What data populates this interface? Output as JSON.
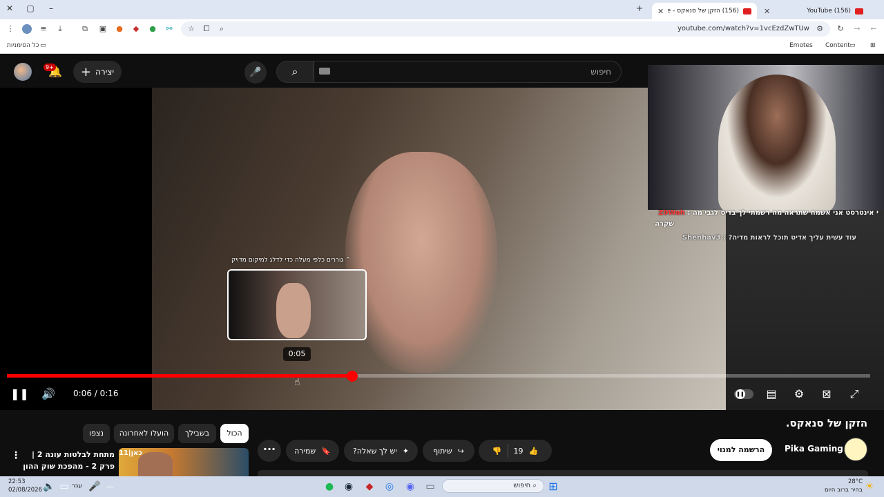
{
  "browser": {
    "tabs": [
      {
        "label": "(156) YouTube"
      },
      {
        "label": "(156) הזקן של סנאקס - be"
      }
    ],
    "new_tab": "+",
    "url": "youtube.com/watch?v=1vcEzdZwTUw",
    "bookmarks": {
      "all_bookmarks": "כל הסימניות",
      "emotes": "Emotes",
      "content": "Content"
    }
  },
  "header": {
    "notifications_badge": "9+",
    "create_label": "יצירה",
    "search_placeholder": "חיפוש"
  },
  "player": {
    "current_time": "0:06",
    "duration": "0:16",
    "timeline_text": "0:06 / 0:16",
    "progress_fraction": 0.4,
    "hover_time": "0:05",
    "preview_hint": "גוררים כלפי מעלה כדי לדלג למיקום מדויק"
  },
  "stream_overlay": {
    "chat": [
      {
        "user": "Z0Wah",
        "text": "י אינטרסט אני אשמח שתראה מה רשמתי לך בדיס לגבי מה :"
      },
      {
        "user": "",
        "text": "שקרה"
      },
      {
        "user": "Shenhav3",
        "text": "עוד עשית עליך אדיט תוכל לראות מדיה?"
      }
    ]
  },
  "video": {
    "title": "הזקן של סנאקס.",
    "channel": "Pika Gaming",
    "subscribe_label": "הרשמה למנוי",
    "like_count": "19",
    "share_label": "שיתוף",
    "ask_label": "יש לך שאלה?",
    "save_label": "שמירה"
  },
  "chips": [
    {
      "label": "הכול",
      "active": true
    },
    {
      "label": "בשבילך"
    },
    {
      "label": "הועלו לאחרונה"
    },
    {
      "label": "נצפו"
    }
  ],
  "recommendation": {
    "title": "מתחת לבלטות עונה 2 | פרק 2 - מהפכת שוק ההון",
    "thumb_brand": "כאן|11"
  },
  "taskbar": {
    "search_label": "חיפוש",
    "time": "22:53",
    "date": "02/08/2026",
    "lang": "עבר",
    "weather_temp": "28°C",
    "weather_text": "בהיר ברוב היום"
  },
  "colors": {
    "youtube_red": "#ff0000",
    "page_bg": "#0f0f0f",
    "chip_bg": "#272727"
  }
}
